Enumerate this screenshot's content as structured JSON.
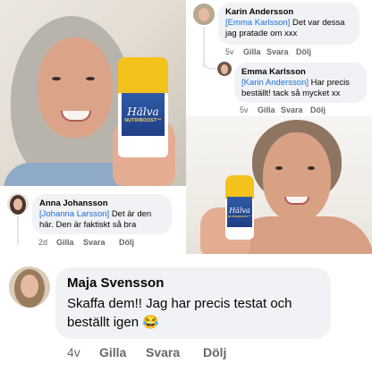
{
  "product": {
    "brand": "Hälva",
    "sub_label": "NUTRIBOOST™"
  },
  "comments": [
    {
      "author": "Karin Andersson",
      "mention": "[Emma Karlsson]",
      "text": "Det var dessa jag pratade om xxx",
      "time": "5v",
      "actions": [
        "Gilla",
        "Svara",
        "Dölj"
      ]
    },
    {
      "author": "Emma Karlsson",
      "mention": "[Karin Andersson]",
      "text": "Har precis beställt! tack så mycket xx",
      "time": "5v",
      "actions": [
        "Gilla",
        "Svara",
        "Dölj"
      ]
    },
    {
      "author": "Anna Johansson",
      "mention": "[Johanna Larsson]",
      "text": "Det är den här. Den är faktiskt så bra",
      "time": "2d",
      "actions": [
        "Gilla",
        "Svara",
        "Dölj"
      ]
    },
    {
      "author": "Maja Svensson",
      "text": "Skaffa dem!! Jag har precis testat och beställt igen 😂",
      "time": "4v",
      "actions": [
        "Gilla",
        "Svara",
        "Dölj"
      ]
    }
  ],
  "colors": {
    "mention": "#216fdb",
    "bubble": "#f0f2f5",
    "meta": "#65676b",
    "product_yellow": "#f3c21d",
    "product_blue": "#2f5aa6"
  }
}
